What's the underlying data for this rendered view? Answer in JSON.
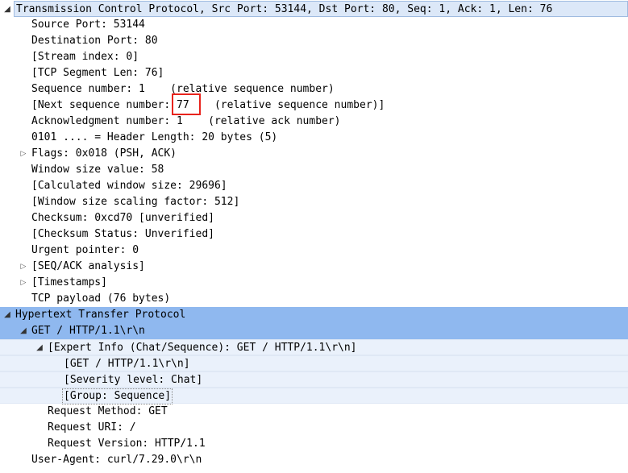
{
  "rows": [
    {
      "text": "Transmission Control Protocol, Src Port: 53144, Dst Port: 80, Seq: 1, Ack: 1, Len: 76",
      "indent": 0,
      "arrow": "expanded",
      "style": "header"
    },
    {
      "text": "Source Port: 53144",
      "indent": 1,
      "arrow": "",
      "style": ""
    },
    {
      "text": "Destination Port: 80",
      "indent": 1,
      "arrow": "",
      "style": ""
    },
    {
      "text": "[Stream index: 0]",
      "indent": 1,
      "arrow": "",
      "style": ""
    },
    {
      "text": "[TCP Segment Len: 76]",
      "indent": 1,
      "arrow": "",
      "style": ""
    },
    {
      "text": "Sequence number: 1    (relative sequence number)",
      "indent": 1,
      "arrow": "",
      "style": ""
    },
    {
      "text": "[Next sequence number: 77    (relative sequence number)]",
      "indent": 1,
      "arrow": "",
      "style": ""
    },
    {
      "text": "Acknowledgment number: 1    (relative ack number)",
      "indent": 1,
      "arrow": "",
      "style": ""
    },
    {
      "text": "0101 .... = Header Length: 20 bytes (5)",
      "indent": 1,
      "arrow": "",
      "style": ""
    },
    {
      "text": "Flags: 0x018 (PSH, ACK)",
      "indent": 1,
      "arrow": "collapsed",
      "style": ""
    },
    {
      "text": "Window size value: 58",
      "indent": 1,
      "arrow": "",
      "style": ""
    },
    {
      "text": "[Calculated window size: 29696]",
      "indent": 1,
      "arrow": "",
      "style": ""
    },
    {
      "text": "[Window size scaling factor: 512]",
      "indent": 1,
      "arrow": "",
      "style": ""
    },
    {
      "text": "Checksum: 0xcd70 [unverified]",
      "indent": 1,
      "arrow": "",
      "style": ""
    },
    {
      "text": "[Checksum Status: Unverified]",
      "indent": 1,
      "arrow": "",
      "style": ""
    },
    {
      "text": "Urgent pointer: 0",
      "indent": 1,
      "arrow": "",
      "style": ""
    },
    {
      "text": "[SEQ/ACK analysis]",
      "indent": 1,
      "arrow": "collapsed",
      "style": ""
    },
    {
      "text": "[Timestamps]",
      "indent": 1,
      "arrow": "collapsed",
      "style": ""
    },
    {
      "text": "TCP payload (76 bytes)",
      "indent": 1,
      "arrow": "",
      "style": ""
    },
    {
      "text": "Hypertext Transfer Protocol",
      "indent": 0,
      "arrow": "expanded",
      "style": "sel-dark"
    },
    {
      "text": "GET / HTTP/1.1\\r\\n",
      "indent": 1,
      "arrow": "expanded",
      "style": "sel-dark"
    },
    {
      "text": "[Expert Info (Chat/Sequence): GET / HTTP/1.1\\r\\n]",
      "indent": 2,
      "arrow": "expanded",
      "style": "sel-light"
    },
    {
      "text": "[GET / HTTP/1.1\\r\\n]",
      "indent": 3,
      "arrow": "",
      "style": "sel-light"
    },
    {
      "text": "[Severity level: Chat]",
      "indent": 3,
      "arrow": "",
      "style": "sel-light"
    },
    {
      "text": "[Group: Sequence]",
      "indent": 3,
      "arrow": "",
      "style": "sel-light-focus"
    },
    {
      "text": "Request Method: GET",
      "indent": 2,
      "arrow": "",
      "style": ""
    },
    {
      "text": "Request URI: /",
      "indent": 2,
      "arrow": "",
      "style": ""
    },
    {
      "text": "Request Version: HTTP/1.1",
      "indent": 2,
      "arrow": "",
      "style": ""
    },
    {
      "text": "User-Agent: curl/7.29.0\\r\\n",
      "indent": 1,
      "arrow": "",
      "style": ""
    }
  ],
  "icons": {
    "expanded": "expanded-arrow-icon",
    "collapsed": "collapsed-arrow-icon"
  },
  "colors": {
    "selection": "#8fb8ef",
    "selection_light": "#eaf1fb",
    "header_bg": "#dce8f8",
    "annotation_box": "#e8231c"
  }
}
